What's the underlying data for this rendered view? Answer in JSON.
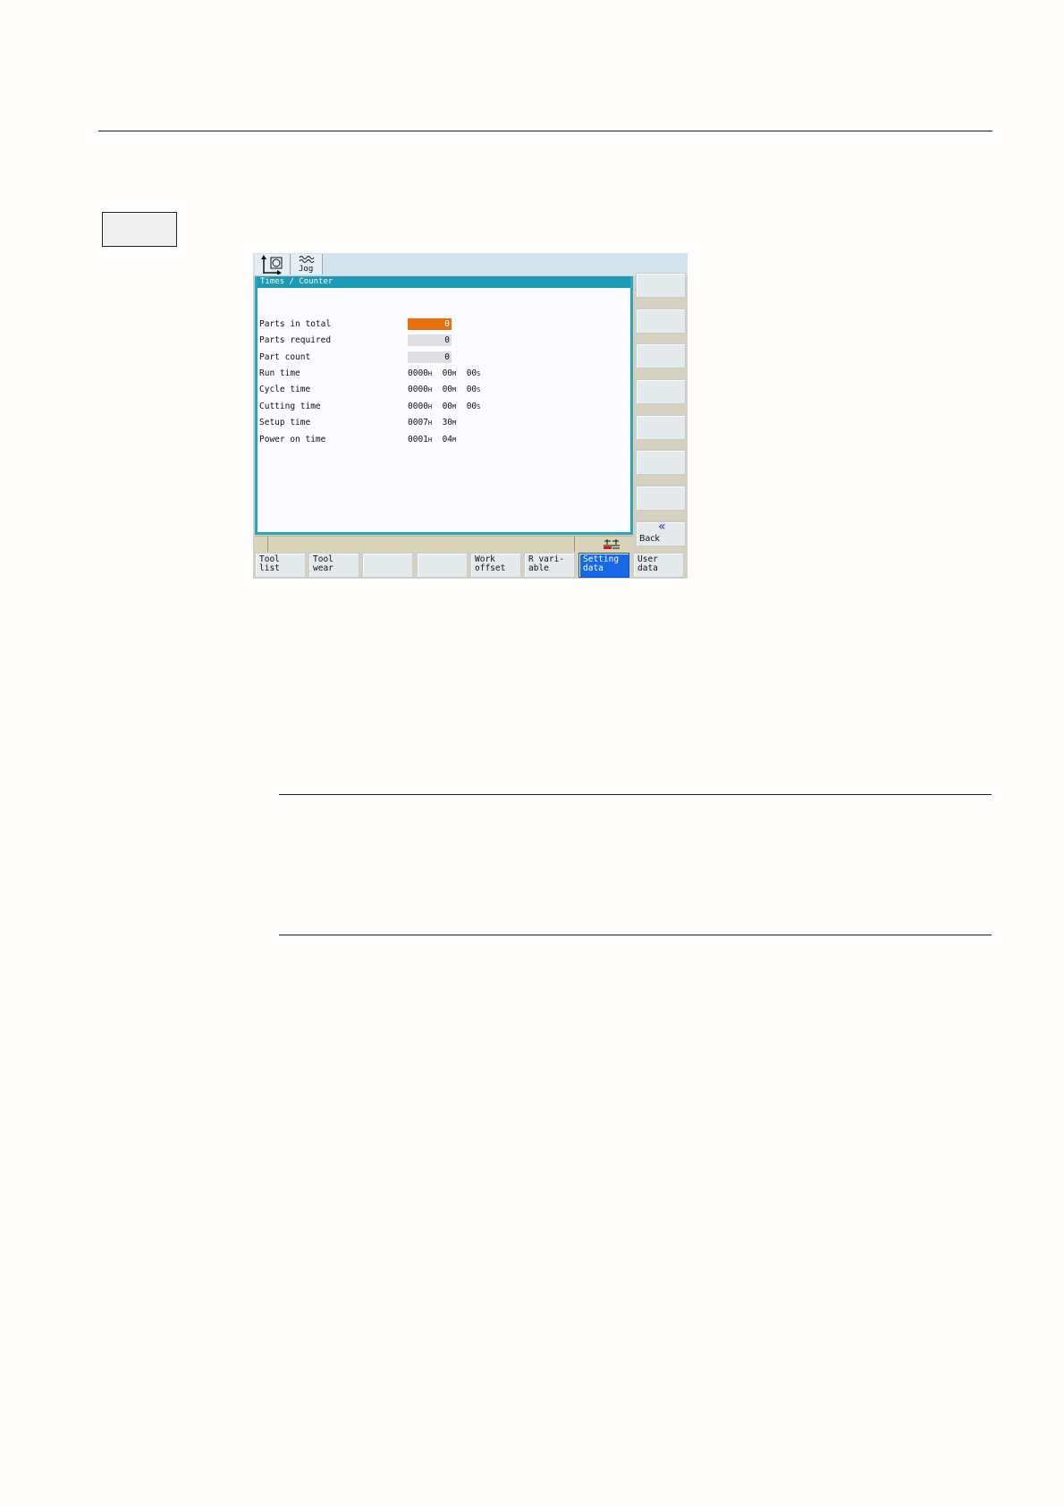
{
  "hmi": {
    "header": {
      "mode_label": "Jog"
    },
    "window": {
      "title": "Times / Counter",
      "rows": [
        {
          "label": "Parts in total",
          "value": "0"
        },
        {
          "label": "Parts required",
          "value": "0"
        },
        {
          "label": "Part count",
          "value": "0"
        },
        {
          "label": "Run time",
          "h": "0000",
          "m": "00",
          "s": "00"
        },
        {
          "label": "Cycle time",
          "h": "0000",
          "m": "00",
          "s": "00"
        },
        {
          "label": "Cutting time",
          "h": "0000",
          "m": "00",
          "s": "00"
        },
        {
          "label": "Setup time",
          "h": "0007",
          "m": "30"
        },
        {
          "label": "Power on time",
          "h": "0001",
          "m": "04"
        }
      ],
      "units": {
        "h": "H",
        "m": "M",
        "s": "S"
      }
    },
    "vertical_softkeys": {
      "back_label": "Back",
      "back_icon": "«"
    },
    "horizontal_softkeys": [
      {
        "line1": "Tool",
        "line2": "list"
      },
      {
        "line1": "Tool",
        "line2": "wear"
      },
      {
        "line1": "",
        "line2": ""
      },
      {
        "line1": "",
        "line2": ""
      },
      {
        "line1": "Work",
        "line2": "offset"
      },
      {
        "line1": "R vari-",
        "line2": "able"
      },
      {
        "line1": "Setting",
        "line2": "data"
      },
      {
        "line1": "User",
        "line2": "data"
      }
    ],
    "colors": {
      "active_field": "#e8700a",
      "selected_softkey": "#1668e8",
      "window_frame": "#26a6c4"
    }
  }
}
